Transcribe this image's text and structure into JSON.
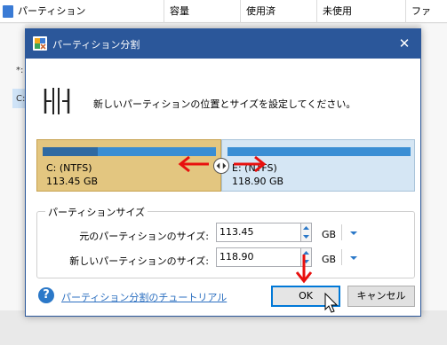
{
  "background": {
    "columns": [
      "パーティション",
      "容量",
      "使用済",
      "未使用",
      "ファ"
    ],
    "fragments": [
      "*:",
      "C:"
    ]
  },
  "dialog": {
    "title": "パーティション分割",
    "instruction": "新しいパーティションの位置とサイズを設定してください。",
    "left_partition": {
      "name": "C: (NTFS)",
      "size": "113.45 GB",
      "used_fraction": 0.32
    },
    "right_partition": {
      "name": "E: (NTFS)",
      "size": "118.90 GB"
    },
    "size_group": {
      "title": "パーティションサイズ",
      "original_label": "元のパーティションのサイズ:",
      "original_value": "113.45",
      "new_label": "新しいパーティションのサイズ:",
      "new_value": "118.90",
      "unit": "GB"
    },
    "help_link": "パーティション分割のチュートリアル",
    "ok_label": "OK",
    "cancel_label": "キャンセル"
  },
  "colors": {
    "titlebar": "#2b579a",
    "left_partition": "#e3c680",
    "right_partition": "#d5e6f4",
    "bar": "#3a8ed4",
    "annotation_arrows": "#e8100e"
  }
}
